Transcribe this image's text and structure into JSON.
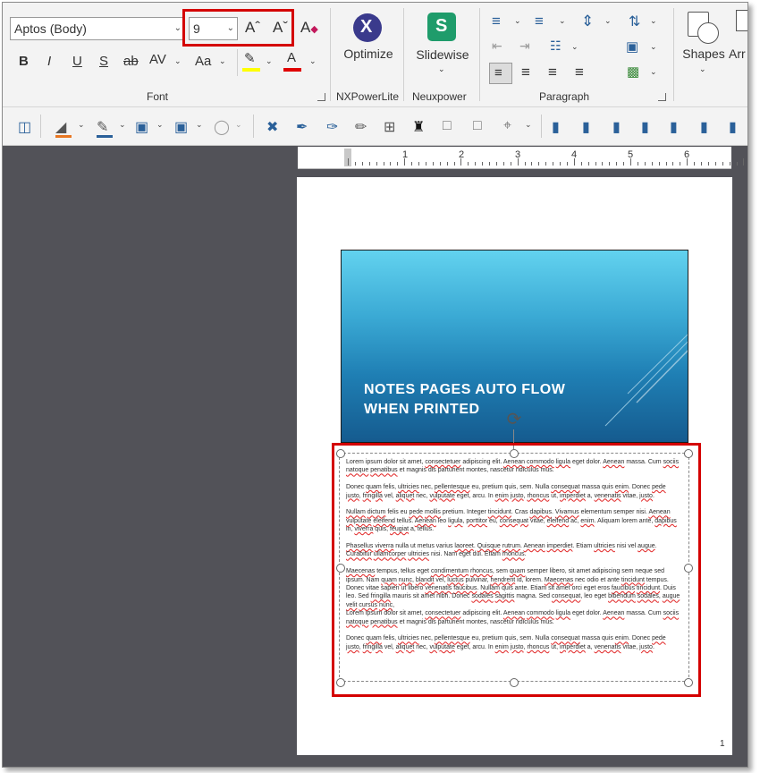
{
  "ribbon": {
    "font_name": "Aptos (Body)",
    "font_size": "9",
    "grow_glyph": "Aˆ",
    "shrink_glyph": "Aˇ",
    "clear_glyph": "A",
    "bold": "B",
    "italic": "I",
    "underline": "U",
    "shadow": "S",
    "strike": "ab",
    "spacing": "AV",
    "case": "Aa",
    "highlight_glyph": "✎",
    "font_color_glyph": "A",
    "font_group_label": "Font",
    "nxpower_button": "Optimize",
    "nxpower_group_label": "NXPowerLite",
    "slidewise_button": "Slidewise",
    "slidewise_glyph": "S",
    "neuxpower_group_label": "Neuxpower",
    "paragraph_group_label": "Paragraph",
    "shapes_label": "Shapes",
    "arrange_label": "Arr"
  },
  "ruler": {
    "numbers": [
      "1",
      "2",
      "3",
      "4",
      "5",
      "6"
    ]
  },
  "slide": {
    "title_line1": "NOTES PAGES AUTO FLOW",
    "title_line2": "WHEN PRINTED"
  },
  "notes": {
    "paragraphs": [
      "Lorem ipsum dolor sit amet, consectetuer adipiscing elit. Aenean commodo ligula eget dolor. Aenean massa. Cum sociis natoque penatibus et magnis dis parturient montes, nascetur ridiculus mus.",
      "Donec quam felis, ultricies nec, pellentesque eu, pretium quis, sem. Nulla consequat massa quis enim. Donec pede justo, fringilla vel, aliquet nec, vulputate eget, arcu. In enim justo, rhoncus ut, imperdiet a, venenatis vitae, justo.",
      "Nullam dictum felis eu pede mollis pretium. Integer tincidunt. Cras dapibus. Vivamus elementum semper nisi. Aenean vulputate eleifend tellus. Aenean leo ligula, porttitor eu, consequat vitae, eleifend ac, enim. Aliquam lorem ante, dapibus in, viverra quis, feugiat a, tellus.",
      "Phasellus viverra nulla ut metus varius laoreet. Quisque rutrum. Aenean imperdiet. Etiam ultricies nisi vel augue. Curabitur ullamcorper ultricies nisi. Nam eget dui. Etiam rhoncus.",
      "Maecenas tempus, tellus eget condimentum rhoncus, sem quam semper libero, sit amet adipiscing sem neque sed ipsum. Nam quam nunc, blandit vel, luctus pulvinar, hendrerit id, lorem. Maecenas nec odio et ante tincidunt tempus. Donec vitae sapien ut libero venenatis faucibus. Nullam quis ante. Etiam sit amet orci eget eros faucibus tincidunt. Duis leo. Sed fringilla mauris sit amet nibh. Donec sodales sagittis magna. Sed consequat, leo eget bibendum sodales, augue velit cursus nunc,",
      "Lorem ipsum dolor sit amet, consectetuer adipiscing elit. Aenean commodo ligula eget dolor. Aenean massa. Cum sociis natoque penatibus et magnis dis parturient montes, nascetur ridiculus mus.",
      "Donec quam felis, ultricies nec, pellentesque eu, pretium quis, sem. Nulla consequat massa quis enim. Donec pede justo, fringilla vel, aliquet nec, vulputate eget, arcu. In enim justo, rhoncus ut, imperdiet a, venenatis vitae, justo."
    ]
  },
  "page_number": "1",
  "colors": {
    "highlight_bar": "#ffff00",
    "font_color_bar": "#e00000",
    "annotation_red": "#d40000",
    "slidewise_green": "#1f9c6b",
    "nxpower_purple": "#3a3a8c"
  }
}
